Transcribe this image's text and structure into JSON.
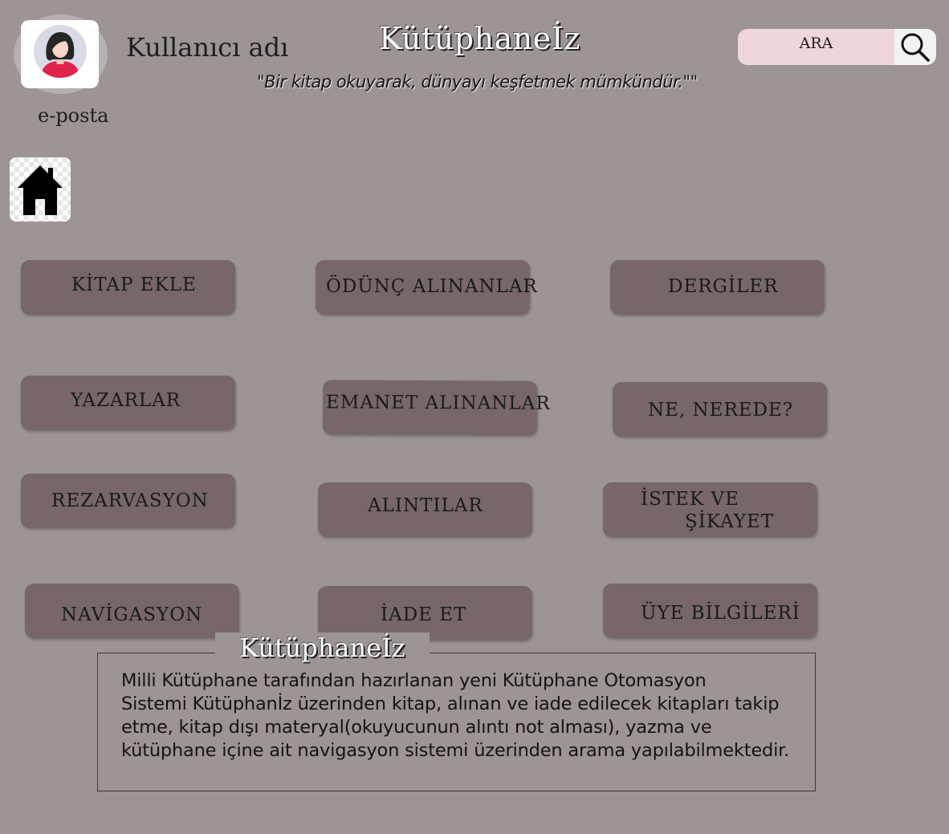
{
  "header": {
    "username": "Kullanıcı adı",
    "email": "e-posta",
    "app_title": "Kütüphaneİz",
    "tagline": "\"Bir kitap okuyarak, dünyayı keşfetmek mümkündür.\"\"",
    "search_placeholder": "ARA",
    "search_icon": "magnifier-icon",
    "avatar_icon": "female-user-icon"
  },
  "nav": {
    "home_icon": "home-icon"
  },
  "menu": {
    "kitap_ekle": "KİTAP EKLE",
    "odunc_alinanlar": "ÖDÜNÇ ALINANLAR",
    "dergiler": "DERGİLER",
    "yazarlar": "YAZARLAR",
    "emanet_alinanlar": "EMANET ALINANLAR",
    "ne_nerede": "NE, NEREDE?",
    "rezarvasyon": "REZARVASYON",
    "alintilar": "ALINTILAR",
    "istek_line1": "İSTEK VE",
    "istek_line2": "ŞİKAYET",
    "navigasyon": "NAVİGASYON",
    "iade_et": "İADE ET",
    "uye_bilgileri": "ÜYE BİLGİLERİ"
  },
  "info": {
    "title": "Kütüphaneİz",
    "line1": "Milli Kütüphane tarafından hazırlanan yeni Kütüphane Otomasyon",
    "line2": "Sistemi Kütüphanİz üzerinden kitap, alınan ve iade edilecek kitapları takip",
    "line3": "etme, kitap dışı materyal(okuyucunun alıntı not alması), yazma ve",
    "line4": "kütüphane içine ait navigasyon sistemi üzerinden arama yapılabilmektedir."
  },
  "colors": {
    "background": "#9d9494",
    "button": "#776767",
    "search_field": "#efd6da",
    "avatar_accent": "#e0234a"
  }
}
